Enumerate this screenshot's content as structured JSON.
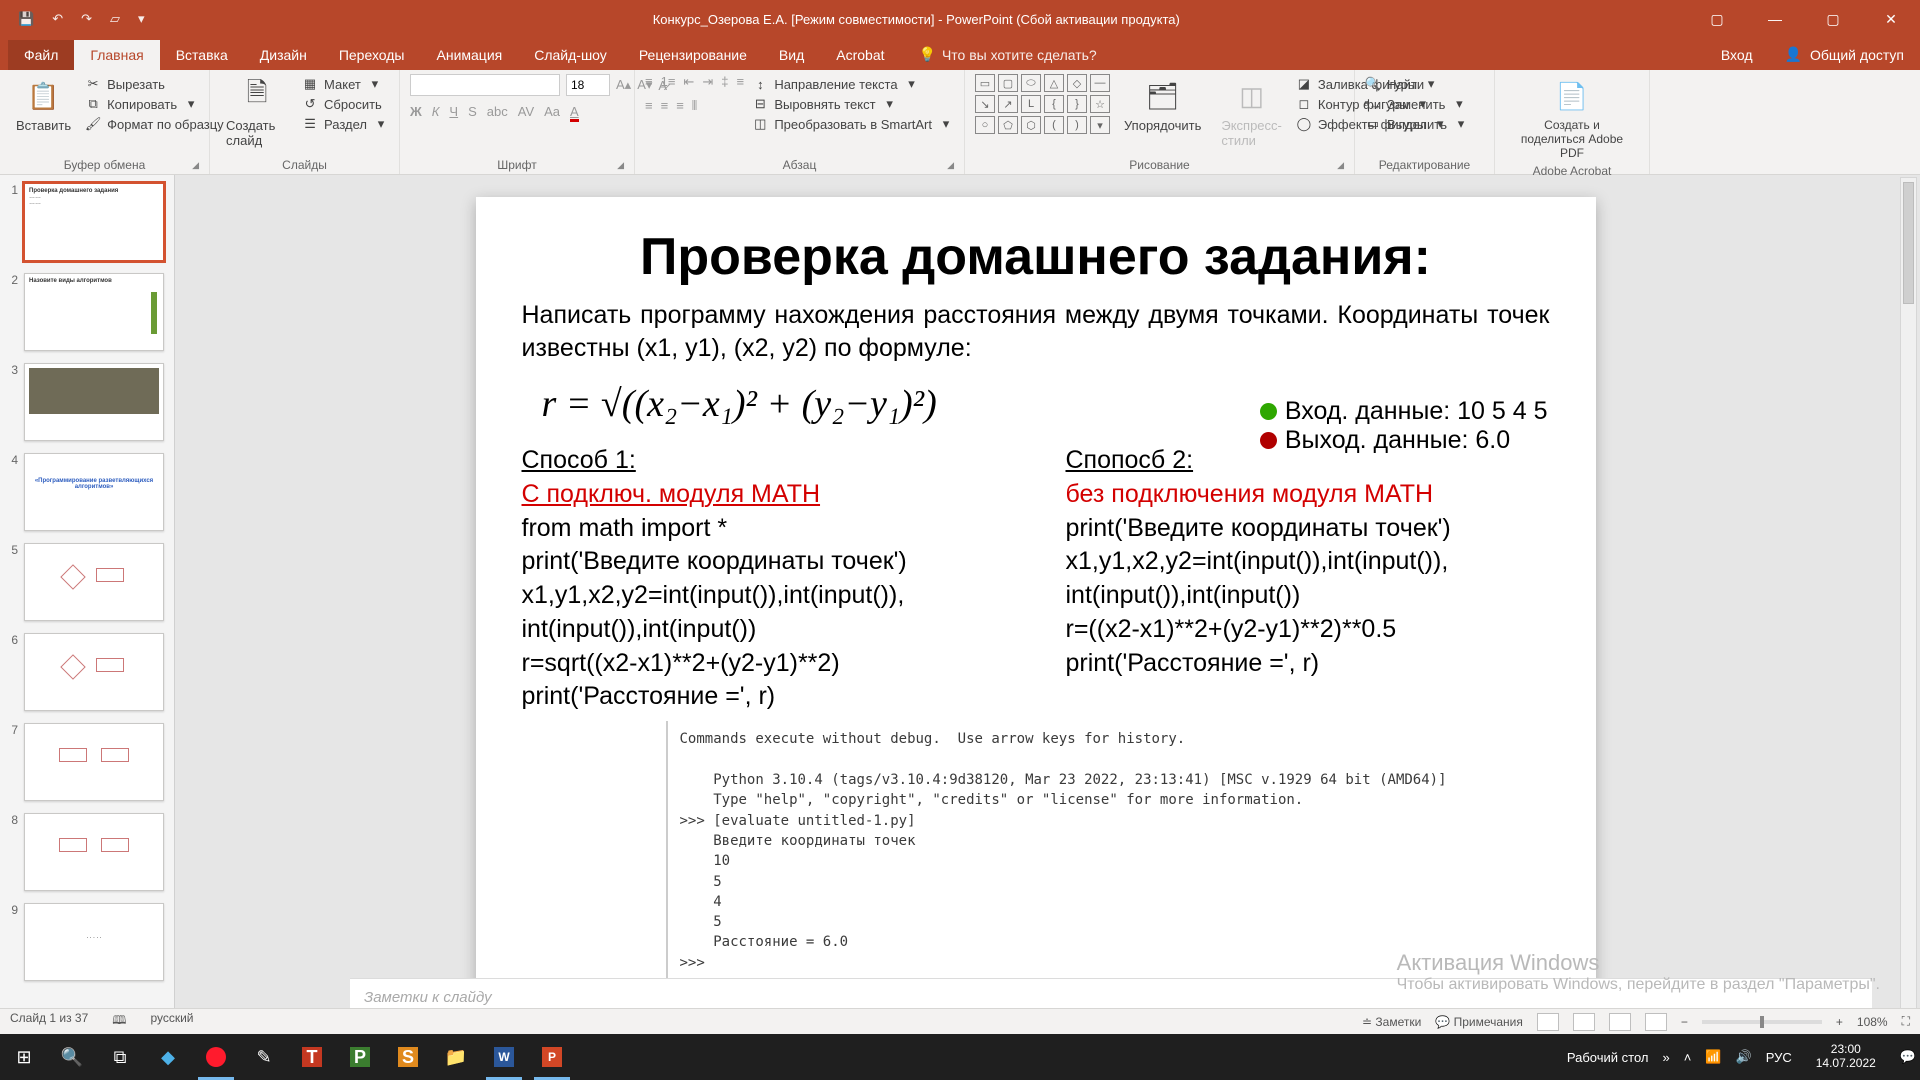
{
  "titlebar": {
    "title": "Конкурс_Озерова Е.А. [Режим совместимости] - PowerPoint (Сбой активации продукта)"
  },
  "tabs": {
    "file": "Файл",
    "items": [
      "Главная",
      "Вставка",
      "Дизайн",
      "Переходы",
      "Анимация",
      "Слайд-шоу",
      "Рецензирование",
      "Вид",
      "Acrobat"
    ],
    "active": "Главная",
    "tell_placeholder": "Что вы хотите сделать?",
    "signin": "Вход",
    "share": "Общий доступ"
  },
  "ribbon": {
    "clipboard": {
      "paste": "Вставить",
      "cut": "Вырезать",
      "copy": "Копировать",
      "format": "Формат по образцу",
      "label": "Буфер обмена"
    },
    "slides": {
      "new": "Создать слайд",
      "layout": "Макет",
      "reset": "Сбросить",
      "section": "Раздел",
      "label": "Слайды"
    },
    "font": {
      "size": "18",
      "label": "Шрифт"
    },
    "para": {
      "dir": "Направление текста",
      "align": "Выровнять текст",
      "smart": "Преобразовать в SmartArt",
      "label": "Абзац"
    },
    "draw": {
      "arrange": "Упорядочить",
      "styles": "Экспресс-стили",
      "fill": "Заливка фигуры",
      "outline": "Контур фигуры",
      "effects": "Эффекты фигуры",
      "label": "Рисование"
    },
    "edit": {
      "find": "Найти",
      "replace": "Заменить",
      "select": "Выделить",
      "label": "Редактирование"
    },
    "acrobat": {
      "create": "Создать и поделиться Adobe PDF",
      "label": "Adobe Acrobat"
    }
  },
  "thumbs": [
    "1",
    "2",
    "3",
    "4",
    "5",
    "6",
    "7",
    "8",
    "9"
  ],
  "slide": {
    "title": "Проверка домашнего задания:",
    "lead": "Написать программу нахождения расстояния между двумя точками. Координаты точек известны (x1, y1), (x2, y2) по формуле:",
    "formula": "r = √((x₂−x₁)² + (y₂−y₁)²)",
    "data_in": "Вход. данные: 10 5 4 5",
    "data_out": "Выход. данные: 6.0",
    "m1": {
      "t": "Способ 1:",
      "r": "С подключ. модуля MATH",
      "lines": [
        "from math import *",
        "print('Введите координаты точек')",
        "x1,y1,x2,y2=int(input()),int(input()),",
        "int(input()),int(input())",
        "r=sqrt((x2-x1)**2+(y2-y1)**2)",
        "print('Расстояние =', r)"
      ]
    },
    "m2": {
      "t": "Спопосб 2:",
      "r": "без подключения модуля MATH",
      "lines": [
        "print('Введите координаты точек')",
        "x1,y1,x2,y2=int(input()),int(input()),",
        "int(input()),int(input())",
        "r=((x2-x1)**2+(y2-y1)**2)**0.5",
        "print('Расстояние =', r)"
      ]
    },
    "term": "Commands execute without debug.  Use arrow keys for history.\n\n    Python 3.10.4 (tags/v3.10.4:9d38120, Mar 23 2022, 23:13:41) [MSC v.1929 64 bit (AMD64)]\n    Type \"help\", \"copyright\", \"credits\" or \"license\" for more information.\n>>> [evaluate untitled-1.py]\n    Введите координаты точек\n    10\n    5\n    4\n    5\n    Расстояние = 6.0\n>>>"
  },
  "notes_placeholder": "Заметки к слайду",
  "status": {
    "slide": "Слайд 1 из 37",
    "lang": "русский",
    "notes": "Заметки",
    "comments": "Примечания",
    "zoom": "108%"
  },
  "watermark": {
    "t": "Активация Windows",
    "s": "Чтобы активировать Windows, перейдите в раздел \"Параметры\"."
  },
  "taskbar": {
    "desktop": "Рабочий стол",
    "lang": "РУС",
    "time": "23:00",
    "date": "14.07.2022"
  }
}
